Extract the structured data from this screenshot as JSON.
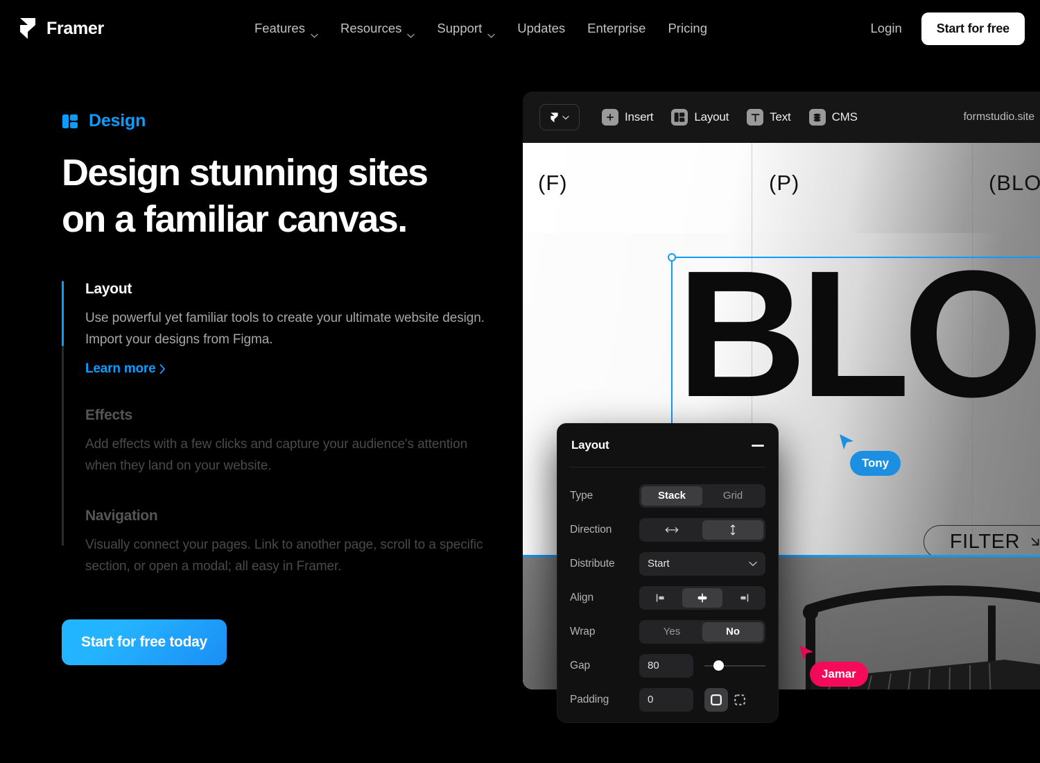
{
  "nav": {
    "brand": "Framer",
    "links": [
      {
        "label": "Features",
        "has_chevron": true
      },
      {
        "label": "Resources",
        "has_chevron": true
      },
      {
        "label": "Support",
        "has_chevron": true
      },
      {
        "label": "Updates",
        "has_chevron": false
      },
      {
        "label": "Enterprise",
        "has_chevron": false
      },
      {
        "label": "Pricing",
        "has_chevron": false
      }
    ],
    "login": "Login",
    "cta": "Start for free"
  },
  "hero": {
    "eyebrow": "Design",
    "eyebrow_icon": "layout-panels-icon",
    "eyebrow_color": "#0a9cff",
    "headline_line1": "Design stunning sites",
    "headline_line2": "on a familiar canvas.",
    "cta": "Start for free today",
    "cta_gradient_from": "#1fb6ff",
    "cta_gradient_to": "#1a8ef5"
  },
  "accordion": {
    "active_color": "#0a9cff",
    "items": [
      {
        "title": "Layout",
        "body": "Use powerful yet familiar tools to create your ultimate website design. Import your designs from Figma.",
        "link": "Learn more",
        "active": true
      },
      {
        "title": "Effects",
        "body": "Add effects with a few clicks and capture your audience's attention when they land on your website.",
        "active": false
      },
      {
        "title": "Navigation",
        "body": "Visually connect your pages. Link to another page, scroll to a specific section, or open a modal; all easy in Framer.",
        "active": false
      }
    ]
  },
  "app": {
    "toolbar": {
      "logo_icon": "framer-logo-icon",
      "logo_chevron_icon": "chevron-down-icon",
      "items": [
        {
          "label": "Insert",
          "icon": "plus-icon"
        },
        {
          "label": "Layout",
          "icon": "layout-panels-icon"
        },
        {
          "label": "Text",
          "icon": "text-t-icon"
        },
        {
          "label": "CMS",
          "icon": "database-icon"
        }
      ],
      "url": "formstudio.site"
    },
    "canvas": {
      "page_labels": [
        "(F)",
        "(P)",
        "(BLO"
      ],
      "big_text": "BLO",
      "filter_button": "FILTER",
      "filter_icon": "arrow-down-right-icon",
      "selection_color": "#0a9cff",
      "cursors": [
        {
          "name": "Tony",
          "color": "#1d8fe0"
        },
        {
          "name": "Jamar",
          "color": "#f60b5a"
        }
      ]
    },
    "panel": {
      "title": "Layout",
      "minimize_icon": "minimize-icon",
      "rows": {
        "type": {
          "label": "Type",
          "options": [
            "Stack",
            "Grid"
          ],
          "selected": "Stack"
        },
        "direction": {
          "label": "Direction",
          "options": [
            "horizontal",
            "vertical"
          ],
          "selected": "vertical"
        },
        "distribute": {
          "label": "Distribute",
          "value": "Start"
        },
        "align": {
          "label": "Align",
          "options": [
            "start",
            "center",
            "end"
          ],
          "selected": "center"
        },
        "wrap": {
          "label": "Wrap",
          "options": [
            "Yes",
            "No"
          ],
          "selected": "No"
        },
        "gap": {
          "label": "Gap",
          "value": "80",
          "slider_percent": 15
        },
        "padding": {
          "label": "Padding",
          "value": "0",
          "modes": [
            "all",
            "individual"
          ],
          "selected": "all"
        }
      }
    }
  }
}
